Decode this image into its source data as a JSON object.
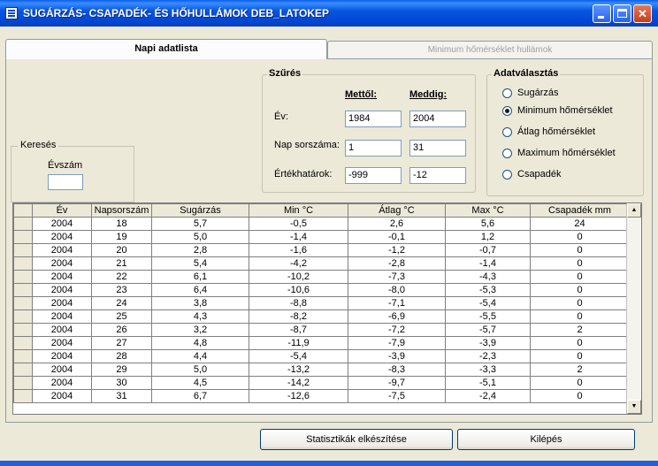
{
  "window": {
    "title": "SUGÁRZÁS- CSAPADÉK- ÉS HŐHULLÁMOK DEB_LATOKEP"
  },
  "tabs": [
    {
      "label": "Napi adatlista",
      "active": true
    },
    {
      "label": "Minimum hőmérséklet hullámok",
      "active": false
    }
  ],
  "search": {
    "legend": "Keresés",
    "year_label": "Évszám",
    "year_value": ""
  },
  "filter": {
    "legend": "Szűrés",
    "from_header": "Mettől:",
    "to_header": "Meddig:",
    "rows": [
      {
        "label": "Év:",
        "from": "1984",
        "to": "2004"
      },
      {
        "label": "Nap sorszáma:",
        "from": "1",
        "to": "31"
      },
      {
        "label": "Értékhatárok:",
        "from": "-999",
        "to": "-12"
      }
    ]
  },
  "data_select": {
    "legend": "Adatválasztás",
    "options": [
      {
        "label": "Sugárzás",
        "checked": false
      },
      {
        "label": "Minimum hőmérséklet",
        "checked": true
      },
      {
        "label": "Átlag hőmérséklet",
        "checked": false
      },
      {
        "label": "Maximum hőmérséklet",
        "checked": false
      },
      {
        "label": "Csapadék",
        "checked": false
      }
    ]
  },
  "table": {
    "columns": [
      "Év",
      "Napsorszám",
      "Sugárzás",
      "Min °C",
      "Átlag °C",
      "Max °C",
      "Csapadék mm"
    ],
    "rows": [
      [
        "2004",
        "18",
        "5,7",
        "-0,5",
        "2,6",
        "5,6",
        "24"
      ],
      [
        "2004",
        "19",
        "5,0",
        "-1,4",
        "-0,1",
        "1,2",
        "0"
      ],
      [
        "2004",
        "20",
        "2,8",
        "-1,6",
        "-1,2",
        "-0,7",
        "0"
      ],
      [
        "2004",
        "21",
        "5,4",
        "-4,2",
        "-2,8",
        "-1,4",
        "0"
      ],
      [
        "2004",
        "22",
        "6,1",
        "-10,2",
        "-7,3",
        "-4,3",
        "0"
      ],
      [
        "2004",
        "23",
        "6,4",
        "-10,6",
        "-8,0",
        "-5,3",
        "0"
      ],
      [
        "2004",
        "24",
        "3,8",
        "-8,8",
        "-7,1",
        "-5,4",
        "0"
      ],
      [
        "2004",
        "25",
        "4,3",
        "-8,2",
        "-6,9",
        "-5,5",
        "0"
      ],
      [
        "2004",
        "26",
        "3,2",
        "-8,7",
        "-7,2",
        "-5,7",
        "2"
      ],
      [
        "2004",
        "27",
        "4,8",
        "-11,9",
        "-7,9",
        "-3,9",
        "0"
      ],
      [
        "2004",
        "28",
        "4,4",
        "-5,4",
        "-3,9",
        "-2,3",
        "0"
      ],
      [
        "2004",
        "29",
        "5,0",
        "-13,2",
        "-8,3",
        "-3,3",
        "2"
      ],
      [
        "2004",
        "30",
        "4,5",
        "-14,2",
        "-9,7",
        "-5,1",
        "0"
      ],
      [
        "2004",
        "31",
        "6,7",
        "-12,6",
        "-7,5",
        "-2,4",
        "0"
      ]
    ]
  },
  "buttons": {
    "stats": "Statisztikák elkészítése",
    "exit": "Kilépés"
  }
}
